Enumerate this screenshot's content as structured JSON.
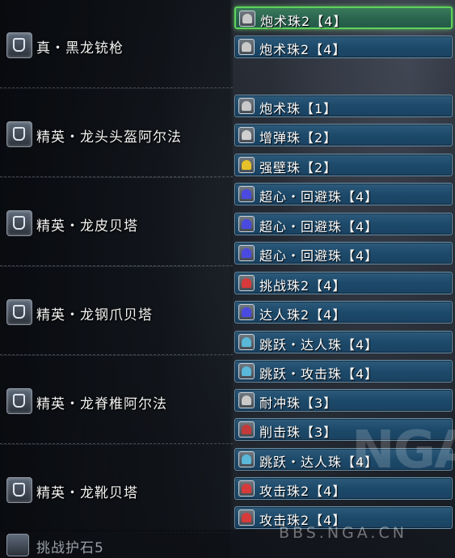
{
  "armor": [
    {
      "name": "真・黑龙铳枪",
      "icon": "gunlance-icon"
    },
    {
      "name": "精英・龙头头盔阿尔法",
      "icon": "helmet-icon"
    },
    {
      "name": "精英・龙皮贝塔",
      "icon": "chest-icon"
    },
    {
      "name": "精英・龙钢爪贝塔",
      "icon": "arms-icon"
    },
    {
      "name": "精英・龙脊椎阿尔法",
      "icon": "waist-icon"
    },
    {
      "name": "精英・龙靴贝塔",
      "icon": "legs-icon"
    }
  ],
  "decorations": [
    {
      "label": "炮术珠2【4】",
      "gem_color": "#c9c9c9",
      "selected": true
    },
    {
      "label": "炮术珠2【4】",
      "gem_color": "#c9c9c9",
      "selected": false
    },
    {
      "label": "炮术珠【1】",
      "gem_color": "#c9c9c9",
      "selected": false
    },
    {
      "label": "增弹珠【2】",
      "gem_color": "#d0d0d0",
      "selected": false
    },
    {
      "label": "强壁珠【2】",
      "gem_color": "#e5c22a",
      "selected": false
    },
    {
      "label": "超心・回避珠【4】",
      "gem_color": "#4a4ae0",
      "selected": false
    },
    {
      "label": "超心・回避珠【4】",
      "gem_color": "#4a4ae0",
      "selected": false
    },
    {
      "label": "超心・回避珠【4】",
      "gem_color": "#4a4ae0",
      "selected": false
    },
    {
      "label": "挑战珠2【4】",
      "gem_color": "#d63a3a",
      "selected": false
    },
    {
      "label": "达人珠2【4】",
      "gem_color": "#4a4ae0",
      "selected": false
    },
    {
      "label": "跳跃・达人珠【4】",
      "gem_color": "#5ab8d8",
      "selected": false
    },
    {
      "label": "跳跃・攻击珠【4】",
      "gem_color": "#5ab8d8",
      "selected": false
    },
    {
      "label": "耐冲珠【3】",
      "gem_color": "#c9c9c9",
      "selected": false
    },
    {
      "label": "削击珠【3】",
      "gem_color": "#c23a3a",
      "selected": false
    },
    {
      "label": "跳跃・达人珠【4】",
      "gem_color": "#5ab8d8",
      "selected": false
    },
    {
      "label": "攻击珠2【4】",
      "gem_color": "#d63a3a",
      "selected": false
    },
    {
      "label": "攻击珠2【4】",
      "gem_color": "#d63a3a",
      "selected": false
    }
  ],
  "charm": {
    "name": "挑战护石5",
    "icon": "charm-icon"
  },
  "watermark": {
    "logo": "NGA",
    "url": "BBS.NGA.CN"
  }
}
